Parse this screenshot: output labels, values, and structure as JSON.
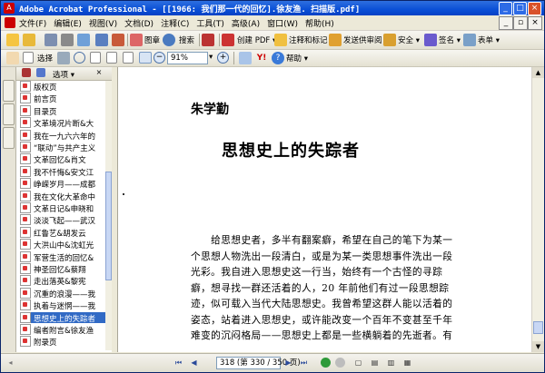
{
  "window": {
    "title": "Adobe Acrobat Professional - [[1966: 我们那一代的回忆].徐友渔. 扫描版.pdf]"
  },
  "menubar": {
    "items": [
      "文件(F)",
      "编辑(E)",
      "视图(V)",
      "文档(D)",
      "注释(C)",
      "工具(T)",
      "高级(A)",
      "窗口(W)",
      "帮助(H)"
    ]
  },
  "toolbar1": {
    "images_label": "图章",
    "search_label": "搜索",
    "create_pdf_label": "创建 PDF",
    "comment_label": "注释和标记",
    "send_review_label": "发送供审阅",
    "security_label": "安全",
    "sign_label": "签名",
    "forms_label": "表单"
  },
  "toolbar2": {
    "select_label": "选择",
    "zoom_value": "91%",
    "help_label": "帮助"
  },
  "panel": {
    "options_label": "选项",
    "bookmarks": [
      {
        "label": "版权页",
        "selected": false
      },
      {
        "label": "前言页",
        "selected": false
      },
      {
        "label": "目录页",
        "selected": false
      },
      {
        "label": "文革境况片断&大",
        "selected": false
      },
      {
        "label": "我在一九六六年的",
        "selected": false
      },
      {
        "label": "“联动”与共产主义",
        "selected": false
      },
      {
        "label": "文革回忆&肖文",
        "selected": false
      },
      {
        "label": "我不忏悔&安文江",
        "selected": false
      },
      {
        "label": "峥嵘岁月——成都",
        "selected": false
      },
      {
        "label": "我在文化大革命中",
        "selected": false
      },
      {
        "label": "文革日记&申晓和",
        "selected": false
      },
      {
        "label": "淡淡飞起——武汉",
        "selected": false
      },
      {
        "label": "红鲁艺&胡发云",
        "selected": false
      },
      {
        "label": "大洪山中&沈虹光",
        "selected": false
      },
      {
        "label": "军营生活的回忆&",
        "selected": false
      },
      {
        "label": "神圣回忆&蔡翔",
        "selected": false
      },
      {
        "label": "走出落英&黎宪",
        "selected": false
      },
      {
        "label": "沉重的浪漫——我",
        "selected": false
      },
      {
        "label": "执着与迷惘——我",
        "selected": false
      },
      {
        "label": "思想史上的失踪者",
        "selected": true
      },
      {
        "label": "编者附言&徐友渔",
        "selected": false
      },
      {
        "label": "附录页",
        "selected": false
      }
    ]
  },
  "document": {
    "author": "朱学勤",
    "heading": "思想史上的失踪者",
    "lines": [
      "　　给思想史者，多半有翻案癖，希望在自己的笔下为某一",
      "个思想人物洗出一段清白，或是为某一类思想事件洗出一段",
      "光彩。我自进入思想史这一行当，始终有一个古怪的寻踪",
      "癖，想寻找一群还活着的人，20 年前他们有过一段思想踪",
      "迹，似可载入当代大陆思想史。我曾希望这群人能以活着的",
      "姿态，站着进入思想史，或许能改变一个百年不变甚至千年",
      "难变的沉闷格局——思想史上都是一些横躺着的先逝者。有",
      "　　　　　　　　　　　　　　　　　　　　　　　　　　"
    ]
  },
  "statusbar": {
    "page_indicator": "318 (第 330 / 350 页)"
  }
}
